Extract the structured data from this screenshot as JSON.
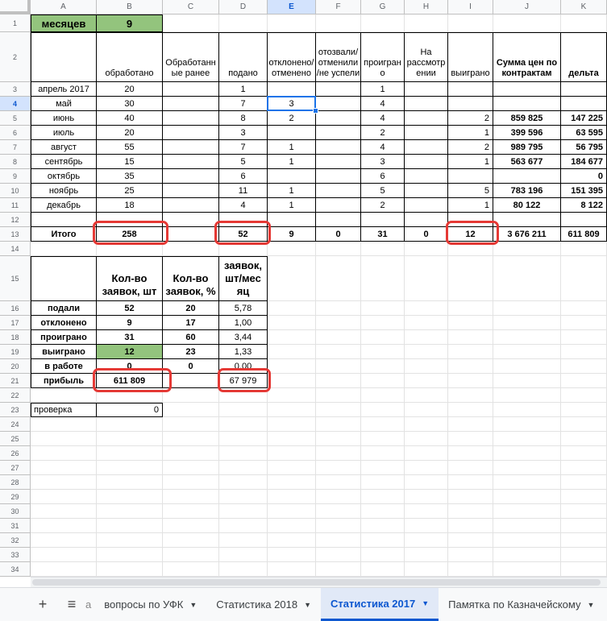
{
  "columns": [
    "A",
    "B",
    "C",
    "D",
    "E",
    "F",
    "G",
    "H",
    "I",
    "J",
    "K"
  ],
  "rows": [
    "1",
    "2",
    "3",
    "4",
    "5",
    "6",
    "7",
    "8",
    "9",
    "10",
    "11",
    "12",
    "13",
    "14",
    "15",
    "16",
    "17",
    "18",
    "19",
    "20",
    "21",
    "22",
    "23",
    "24",
    "25",
    "26",
    "27",
    "28",
    "29",
    "30",
    "31",
    "32",
    "33",
    "34"
  ],
  "selected_column": "E",
  "selected_row": "4",
  "top": {
    "months_label": "месяцев",
    "months_value": "9",
    "headers": [
      "обработано",
      "Обработанн ые ранее",
      "подано",
      "отклонено/ отменено",
      "отозвали/ отменили /не успели",
      "проигран о",
      "На рассмотр ении",
      "выиграно",
      "Сумма цен по контрактам",
      "дельта"
    ],
    "rows": [
      {
        "m": "апрель 2017",
        "b": "20",
        "c": "",
        "d": "1",
        "e": "",
        "f": "",
        "g": "1",
        "h": "",
        "i": "",
        "j": "",
        "k": ""
      },
      {
        "m": "май",
        "b": "30",
        "c": "",
        "d": "7",
        "e": "3",
        "f": "",
        "g": "4",
        "h": "",
        "i": "",
        "j": "",
        "k": ""
      },
      {
        "m": "июнь",
        "b": "40",
        "c": "",
        "d": "8",
        "e": "2",
        "f": "",
        "g": "4",
        "h": "",
        "i": "2",
        "j": "859  825",
        "k": "147 225"
      },
      {
        "m": "июль",
        "b": "20",
        "c": "",
        "d": "3",
        "e": "",
        "f": "",
        "g": "2",
        "h": "",
        "i": "1",
        "j": "399 596",
        "k": "63 595"
      },
      {
        "m": "август",
        "b": "55",
        "c": "",
        "d": "7",
        "e": "1",
        "f": "",
        "g": "4",
        "h": "",
        "i": "2",
        "j": "989 795",
        "k": "56 795"
      },
      {
        "m": "сентябрь",
        "b": "15",
        "c": "",
        "d": "5",
        "e": "1",
        "f": "",
        "g": "3",
        "h": "",
        "i": "1",
        "j": "563 677",
        "k": "184 677"
      },
      {
        "m": "октябрь",
        "b": "35",
        "c": "",
        "d": "6",
        "e": "",
        "f": "",
        "g": "6",
        "h": "",
        "i": "",
        "j": "",
        "k": "0"
      },
      {
        "m": "ноябрь",
        "b": "25",
        "c": "",
        "d": "11",
        "e": "1",
        "f": "",
        "g": "5",
        "h": "",
        "i": "5",
        "j": "783 196",
        "k": "151 395"
      },
      {
        "m": "декабрь",
        "b": "18",
        "c": "",
        "d": "4",
        "e": "1",
        "f": "",
        "g": "2",
        "h": "",
        "i": "1",
        "j": "80 122",
        "k": "8 122"
      }
    ],
    "total": {
      "label": "Итого",
      "b": "258",
      "d": "52",
      "e": "9",
      "f": "0",
      "g": "31",
      "h": "0",
      "i": "12",
      "j": "3 676 211",
      "k": "611 809"
    }
  },
  "summary": {
    "headers": [
      "Кол-во заявок, шт",
      "Кол-во заявок, %",
      "Кол-во заявок, шт/мес яц"
    ],
    "rows": [
      {
        "label": "подали",
        "b": "52",
        "c": "20",
        "d": "5,78"
      },
      {
        "label": "отклонено",
        "b": "9",
        "c": "17",
        "d": "1,00"
      },
      {
        "label": "проиграно",
        "b": "31",
        "c": "60",
        "d": "3,44"
      },
      {
        "label": "выиграно",
        "b": "12",
        "c": "23",
        "d": "1,33"
      },
      {
        "label": "в работе",
        "b": "0",
        "c": "0",
        "d": "0,00"
      },
      {
        "label": "прибыль",
        "b": "611 809",
        "c": "",
        "d": "67 979"
      }
    ],
    "check_label": "проверка",
    "check_value": "0"
  },
  "tabs": {
    "partial": "а",
    "items": [
      "вопросы по УФК",
      "Статистика  2018",
      "Статистика 2017",
      "Памятка по Казначейскому"
    ],
    "active": "Статистика 2017"
  },
  "colors": {
    "highlight_green": "#93c47d",
    "annotation_red": "#e53935",
    "selection_blue": "#1a73e8"
  }
}
